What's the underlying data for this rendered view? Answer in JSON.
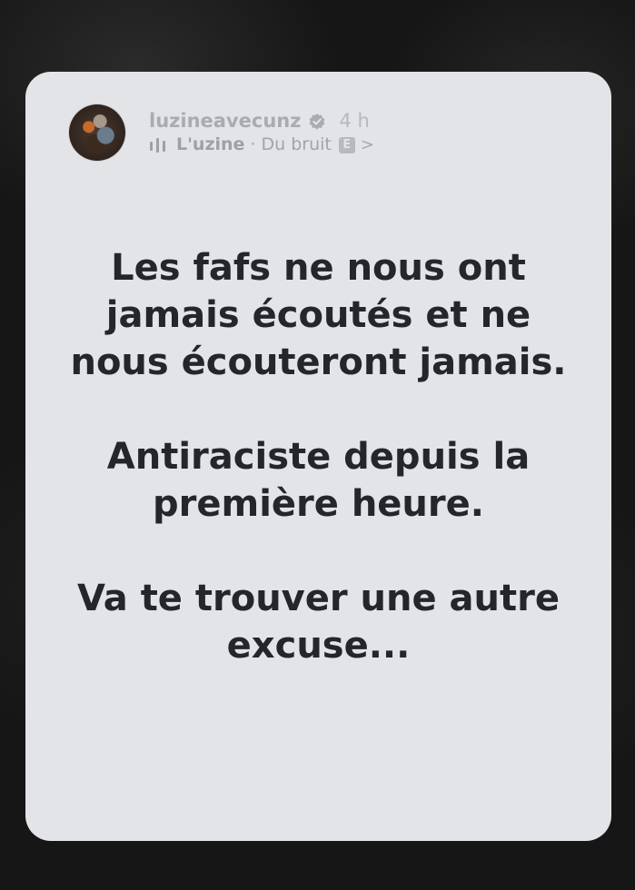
{
  "post": {
    "username": "luzineavecunz",
    "time": "4 h",
    "music": {
      "artist": "L'uzine",
      "separator": "·",
      "track": "Du bruit",
      "explicit_badge": "E",
      "chevron": ">"
    },
    "icons": [
      "verified-badge-icon",
      "audio-bars-icon"
    ],
    "message": {
      "paragraphs": [
        "Les fafs ne nous ont jamais écoutés et ne nous écouteront jamais.",
        "Antiraciste depuis la première heure.",
        "Va te trouver une autre excuse..."
      ]
    }
  },
  "colors": {
    "card_background": "#e3e4e8",
    "text": "#24262b",
    "meta_text": "#aeb0b6",
    "page_background": "#161616"
  }
}
